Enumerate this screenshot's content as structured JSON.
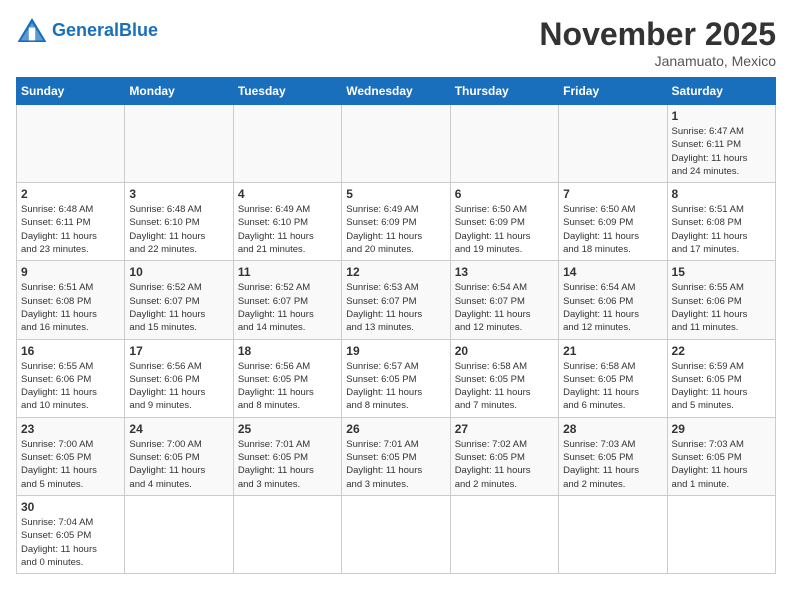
{
  "header": {
    "logo_general": "General",
    "logo_blue": "Blue",
    "month_title": "November 2025",
    "location": "Janamuato, Mexico"
  },
  "weekdays": [
    "Sunday",
    "Monday",
    "Tuesday",
    "Wednesday",
    "Thursday",
    "Friday",
    "Saturday"
  ],
  "weeks": [
    [
      {
        "day": "",
        "info": ""
      },
      {
        "day": "",
        "info": ""
      },
      {
        "day": "",
        "info": ""
      },
      {
        "day": "",
        "info": ""
      },
      {
        "day": "",
        "info": ""
      },
      {
        "day": "",
        "info": ""
      },
      {
        "day": "1",
        "info": "Sunrise: 6:47 AM\nSunset: 6:11 PM\nDaylight: 11 hours\nand 24 minutes."
      }
    ],
    [
      {
        "day": "2",
        "info": "Sunrise: 6:48 AM\nSunset: 6:11 PM\nDaylight: 11 hours\nand 23 minutes."
      },
      {
        "day": "3",
        "info": "Sunrise: 6:48 AM\nSunset: 6:10 PM\nDaylight: 11 hours\nand 22 minutes."
      },
      {
        "day": "4",
        "info": "Sunrise: 6:49 AM\nSunset: 6:10 PM\nDaylight: 11 hours\nand 21 minutes."
      },
      {
        "day": "5",
        "info": "Sunrise: 6:49 AM\nSunset: 6:09 PM\nDaylight: 11 hours\nand 20 minutes."
      },
      {
        "day": "6",
        "info": "Sunrise: 6:50 AM\nSunset: 6:09 PM\nDaylight: 11 hours\nand 19 minutes."
      },
      {
        "day": "7",
        "info": "Sunrise: 6:50 AM\nSunset: 6:09 PM\nDaylight: 11 hours\nand 18 minutes."
      },
      {
        "day": "8",
        "info": "Sunrise: 6:51 AM\nSunset: 6:08 PM\nDaylight: 11 hours\nand 17 minutes."
      }
    ],
    [
      {
        "day": "9",
        "info": "Sunrise: 6:51 AM\nSunset: 6:08 PM\nDaylight: 11 hours\nand 16 minutes."
      },
      {
        "day": "10",
        "info": "Sunrise: 6:52 AM\nSunset: 6:07 PM\nDaylight: 11 hours\nand 15 minutes."
      },
      {
        "day": "11",
        "info": "Sunrise: 6:52 AM\nSunset: 6:07 PM\nDaylight: 11 hours\nand 14 minutes."
      },
      {
        "day": "12",
        "info": "Sunrise: 6:53 AM\nSunset: 6:07 PM\nDaylight: 11 hours\nand 13 minutes."
      },
      {
        "day": "13",
        "info": "Sunrise: 6:54 AM\nSunset: 6:07 PM\nDaylight: 11 hours\nand 12 minutes."
      },
      {
        "day": "14",
        "info": "Sunrise: 6:54 AM\nSunset: 6:06 PM\nDaylight: 11 hours\nand 12 minutes."
      },
      {
        "day": "15",
        "info": "Sunrise: 6:55 AM\nSunset: 6:06 PM\nDaylight: 11 hours\nand 11 minutes."
      }
    ],
    [
      {
        "day": "16",
        "info": "Sunrise: 6:55 AM\nSunset: 6:06 PM\nDaylight: 11 hours\nand 10 minutes."
      },
      {
        "day": "17",
        "info": "Sunrise: 6:56 AM\nSunset: 6:06 PM\nDaylight: 11 hours\nand 9 minutes."
      },
      {
        "day": "18",
        "info": "Sunrise: 6:56 AM\nSunset: 6:05 PM\nDaylight: 11 hours\nand 8 minutes."
      },
      {
        "day": "19",
        "info": "Sunrise: 6:57 AM\nSunset: 6:05 PM\nDaylight: 11 hours\nand 8 minutes."
      },
      {
        "day": "20",
        "info": "Sunrise: 6:58 AM\nSunset: 6:05 PM\nDaylight: 11 hours\nand 7 minutes."
      },
      {
        "day": "21",
        "info": "Sunrise: 6:58 AM\nSunset: 6:05 PM\nDaylight: 11 hours\nand 6 minutes."
      },
      {
        "day": "22",
        "info": "Sunrise: 6:59 AM\nSunset: 6:05 PM\nDaylight: 11 hours\nand 5 minutes."
      }
    ],
    [
      {
        "day": "23",
        "info": "Sunrise: 7:00 AM\nSunset: 6:05 PM\nDaylight: 11 hours\nand 5 minutes."
      },
      {
        "day": "24",
        "info": "Sunrise: 7:00 AM\nSunset: 6:05 PM\nDaylight: 11 hours\nand 4 minutes."
      },
      {
        "day": "25",
        "info": "Sunrise: 7:01 AM\nSunset: 6:05 PM\nDaylight: 11 hours\nand 3 minutes."
      },
      {
        "day": "26",
        "info": "Sunrise: 7:01 AM\nSunset: 6:05 PM\nDaylight: 11 hours\nand 3 minutes."
      },
      {
        "day": "27",
        "info": "Sunrise: 7:02 AM\nSunset: 6:05 PM\nDaylight: 11 hours\nand 2 minutes."
      },
      {
        "day": "28",
        "info": "Sunrise: 7:03 AM\nSunset: 6:05 PM\nDaylight: 11 hours\nand 2 minutes."
      },
      {
        "day": "29",
        "info": "Sunrise: 7:03 AM\nSunset: 6:05 PM\nDaylight: 11 hours\nand 1 minute."
      }
    ],
    [
      {
        "day": "30",
        "info": "Sunrise: 7:04 AM\nSunset: 6:05 PM\nDaylight: 11 hours\nand 0 minutes."
      },
      {
        "day": "",
        "info": ""
      },
      {
        "day": "",
        "info": ""
      },
      {
        "day": "",
        "info": ""
      },
      {
        "day": "",
        "info": ""
      },
      {
        "day": "",
        "info": ""
      },
      {
        "day": "",
        "info": ""
      }
    ]
  ]
}
